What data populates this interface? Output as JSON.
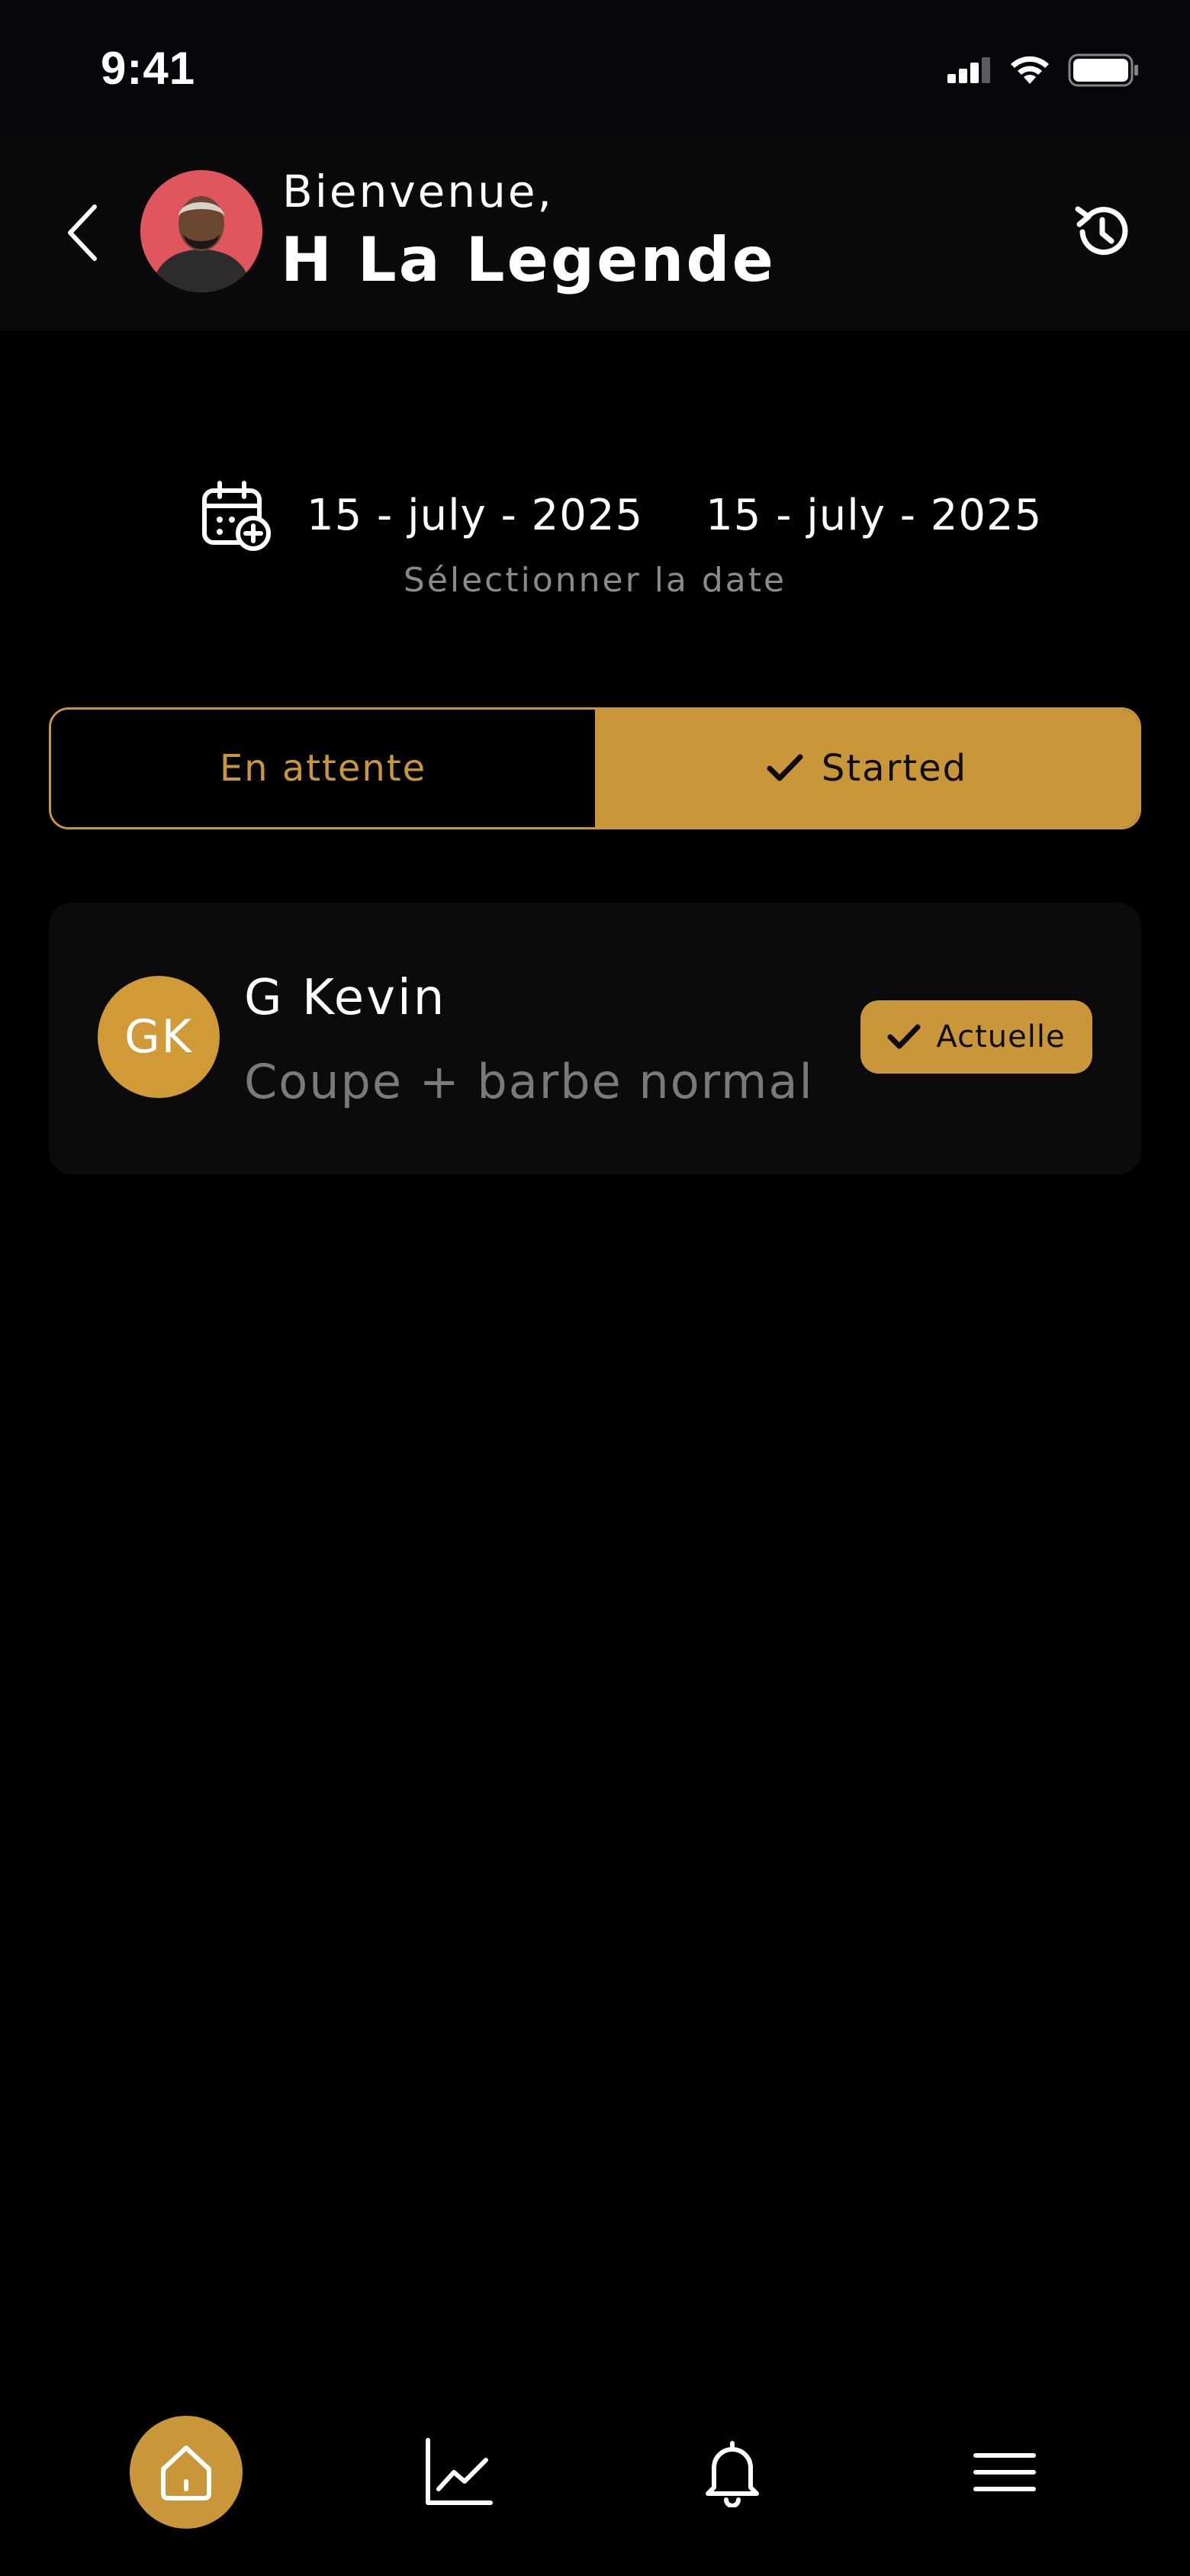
{
  "status_bar": {
    "time": "9:41"
  },
  "header": {
    "greeting": "Bienvenue,",
    "user_name": "H La Legende",
    "icons": {
      "back": "chevron-left-icon",
      "history": "history-icon"
    }
  },
  "date_filter": {
    "start_date": "15 - july - 2025",
    "end_date": "15 - july - 2025",
    "label": "Sélectionner la date",
    "icon": "calendar-add-icon"
  },
  "tabs": [
    {
      "label": "En attente",
      "selected": false
    },
    {
      "label": "Started",
      "selected": true
    }
  ],
  "appointments": [
    {
      "initials": "GK",
      "client_name": "G Kevin",
      "service": "Coupe + barbe normal",
      "status": "Actuelle"
    }
  ],
  "bottom_nav": [
    {
      "icon": "home-icon",
      "active": true
    },
    {
      "icon": "chart-icon",
      "active": false
    },
    {
      "icon": "bell-icon",
      "active": false
    },
    {
      "icon": "menu-icon",
      "active": false
    }
  ],
  "colors": {
    "accent": "#c9963a",
    "background": "#000000",
    "card": "#0b0b0b",
    "muted_text": "#8a8a8a"
  }
}
